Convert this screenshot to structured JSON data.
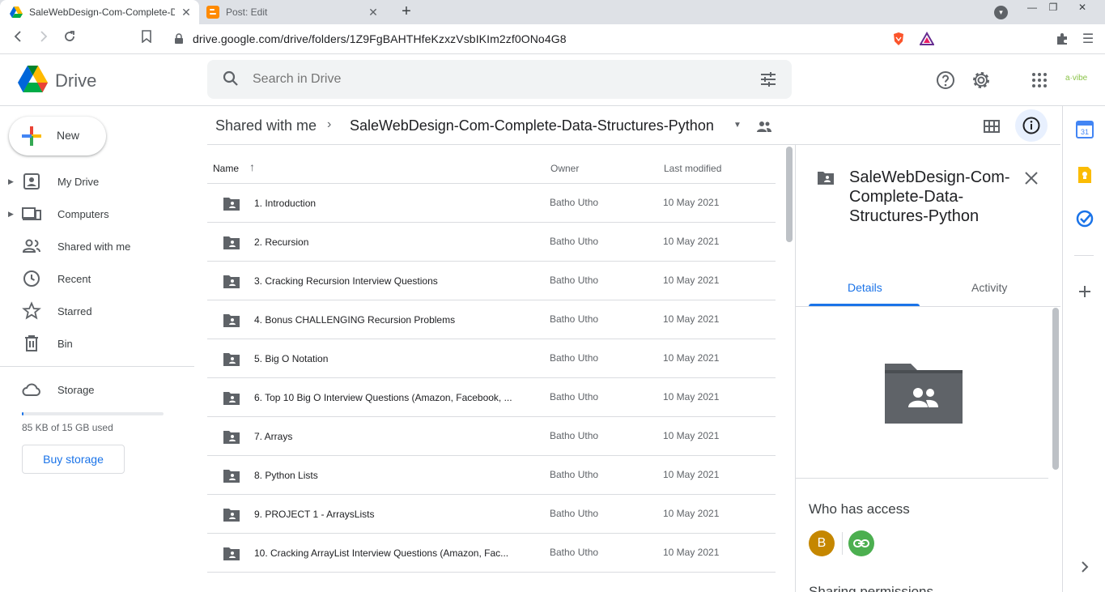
{
  "browser": {
    "tabs": [
      {
        "title": "SaleWebDesign-Com-Complete-D",
        "active": true,
        "close": "✕"
      },
      {
        "title": "Post: Edit",
        "active": false,
        "close": "✕"
      }
    ],
    "new_tab": "+",
    "window_controls": [
      "—",
      "❐",
      "✕"
    ],
    "url": "drive.google.com/drive/folders/1Z9FgBAHTHfeKzxzVsbIKIm2zf0ONo4G8"
  },
  "drive": {
    "app_name": "Drive",
    "search_placeholder": "Search in Drive",
    "brand_text": "a·vibe",
    "new_label": "New",
    "nav": [
      {
        "label": "My Drive",
        "icon": "my-drive-icon",
        "expandable": true
      },
      {
        "label": "Computers",
        "icon": "computers-icon",
        "expandable": true
      },
      {
        "label": "Shared with me",
        "icon": "shared-icon",
        "expandable": false
      },
      {
        "label": "Recent",
        "icon": "clock-icon",
        "expandable": false
      },
      {
        "label": "Starred",
        "icon": "star-icon",
        "expandable": false
      },
      {
        "label": "Bin",
        "icon": "trash-icon",
        "expandable": false
      }
    ],
    "storage": {
      "label": "Storage",
      "used_text": "85 KB of 15 GB used",
      "used_fraction": 0.003,
      "buy_label": "Buy storage"
    }
  },
  "breadcrumb": {
    "parent": "Shared with me",
    "separator": "›",
    "current": "SaleWebDesign-Com-Complete-Data-Structures-Python"
  },
  "list": {
    "columns": {
      "name": "Name",
      "owner": "Owner",
      "modified": "Last modified"
    },
    "sort_indicator": "↑",
    "rows": [
      {
        "name": "1. Introduction",
        "owner": "Batho Utho",
        "modified": "10 May 2021"
      },
      {
        "name": "2. Recursion",
        "owner": "Batho Utho",
        "modified": "10 May 2021"
      },
      {
        "name": "3. Cracking Recursion Interview Questions",
        "owner": "Batho Utho",
        "modified": "10 May 2021"
      },
      {
        "name": "4. Bonus CHALLENGING Recursion Problems",
        "owner": "Batho Utho",
        "modified": "10 May 2021"
      },
      {
        "name": "5. Big O Notation",
        "owner": "Batho Utho",
        "modified": "10 May 2021"
      },
      {
        "name": "6. Top 10 Big O Interview Questions (Amazon, Facebook, ...",
        "owner": "Batho Utho",
        "modified": "10 May 2021"
      },
      {
        "name": "7. Arrays",
        "owner": "Batho Utho",
        "modified": "10 May 2021"
      },
      {
        "name": "8. Python Lists",
        "owner": "Batho Utho",
        "modified": "10 May 2021"
      },
      {
        "name": "9. PROJECT 1 - ArraysLists",
        "owner": "Batho Utho",
        "modified": "10 May 2021"
      },
      {
        "name": "10. Cracking ArrayList Interview Questions (Amazon, Fac...",
        "owner": "Batho Utho",
        "modified": "10 May 2021"
      }
    ]
  },
  "details": {
    "title": "SaleWebDesign-Com-Complete-Data-Structures-Python",
    "tabs": {
      "details": "Details",
      "activity": "Activity"
    },
    "access_heading": "Who has access",
    "avatar_letter": "B",
    "partial_heading": "Sharing permissions"
  },
  "colors": {
    "accent": "#1a73e8",
    "avatar": "#c58700",
    "link_badge": "#4caf50"
  }
}
